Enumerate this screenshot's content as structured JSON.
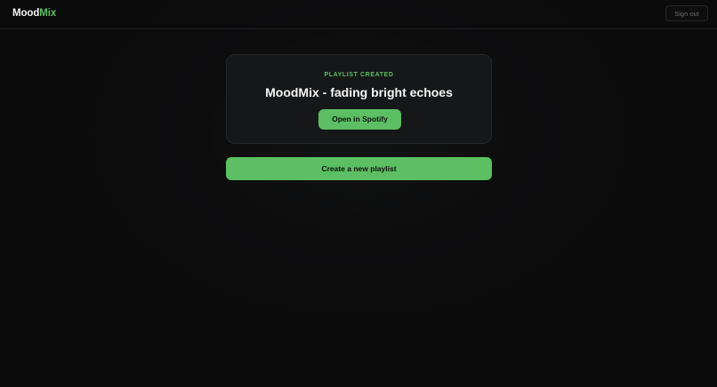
{
  "header": {
    "logo_part1": "Mood",
    "logo_part2": "Mix",
    "signout_label": "Sign out"
  },
  "card": {
    "eyebrow": "PLAYLIST CREATED",
    "title": "MoodMix - fading bright echoes",
    "open_button_label": "Open in Spotify"
  },
  "actions": {
    "create_new_label": "Create a new playlist"
  },
  "colors": {
    "accent": "#5cbf63",
    "background": "#0b0b0c",
    "card": "#161718"
  }
}
